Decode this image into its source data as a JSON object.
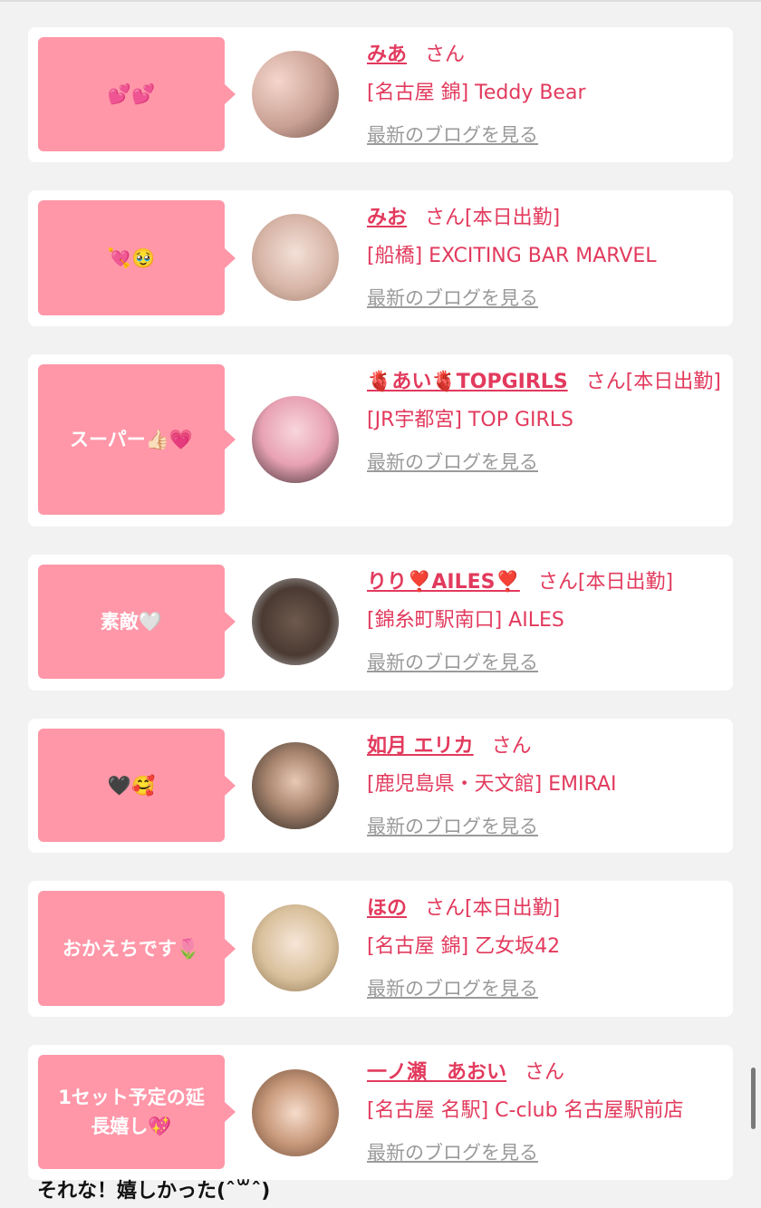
{
  "entries": [
    {
      "comment": "💕💕",
      "name": "みあ",
      "suffix": "さん",
      "shop": "[名古屋 錦] Teddy Bear",
      "blog_link": "最新のブログを見る"
    },
    {
      "comment": "💘🥹",
      "name": "みお",
      "suffix": "さん[本日出勤]",
      "shop": "[船橋] EXCITING BAR MARVEL",
      "blog_link": "最新のブログを見る"
    },
    {
      "comment": "スーパー👍🏻💗",
      "name": "🫀あい🫀TOPGIRLS",
      "suffix": "さん[本日出勤]",
      "shop": "[JR宇都宮] TOP GIRLS",
      "blog_link": "最新のブログを見る"
    },
    {
      "comment": "素敵🤍",
      "name": "りり❣️AILES❣️",
      "suffix": "さん[本日出勤]",
      "shop": "[錦糸町駅南口] AILES",
      "blog_link": "最新のブログを見る"
    },
    {
      "comment": "🖤🥰",
      "name": "如月 エリカ",
      "suffix": "さん",
      "shop": "[鹿児島県・天文館] EMIRAI",
      "blog_link": "最新のブログを見る"
    },
    {
      "comment": "おかえちです🌷",
      "name": "ほの",
      "suffix": "さん[本日出勤]",
      "shop": "[名古屋 錦] 乙女坂42",
      "blog_link": "最新のブログを見る"
    },
    {
      "comment": "1セット予定の延長嬉し💖",
      "name": "一ノ瀬　あおい",
      "suffix": "さん",
      "shop": "[名古屋 名駅] C-club 名古屋駅前店",
      "blog_link": "最新のブログを見る"
    }
  ],
  "caption": "それな！嬉しかった(ˆ꒳ˆ)",
  "colors": {
    "accent": "#e23a5d",
    "bubble": "#ff97a8",
    "link_gray": "#9a9a9a",
    "page_bg": "#f2f2f2"
  }
}
